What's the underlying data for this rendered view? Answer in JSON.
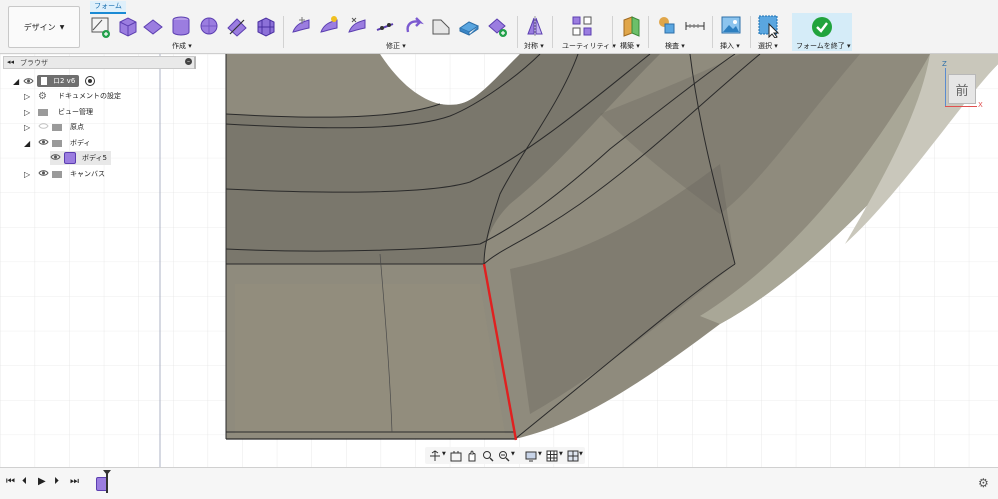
{
  "toolbar": {
    "design_label": "デザイン",
    "active_tab": "フォーム",
    "groups": [
      {
        "label": "作成"
      },
      {
        "label": "修正"
      },
      {
        "label": "対称"
      },
      {
        "label": "ユーティリティ"
      },
      {
        "label": "構築"
      },
      {
        "label": "検査"
      },
      {
        "label": "挿入"
      },
      {
        "label": "選択"
      },
      {
        "label": "フォームを終了"
      }
    ]
  },
  "browser": {
    "title": "ブラウザ",
    "root_label": "ロ2 v6",
    "items": [
      {
        "label": "ドキュメントの設定"
      },
      {
        "label": "ビュー管理"
      },
      {
        "label": "原点"
      },
      {
        "label": "ボディ"
      },
      {
        "label": "ボディ5"
      },
      {
        "label": "キャンバス"
      }
    ]
  },
  "viewcube": {
    "face": "前",
    "axis_x": "X",
    "axis_z": "Z"
  },
  "icons": [
    "select-icon",
    "pan-icon",
    "orbit-icon",
    "zoom-icon",
    "display-icon",
    "grid-icon",
    "settings-icon",
    "checkmark-icon"
  ],
  "colors": {
    "accent": "#1a8ad4",
    "finish": "#21a33c",
    "body": "#8e8a7c",
    "edge_highlight": "#e02020"
  }
}
